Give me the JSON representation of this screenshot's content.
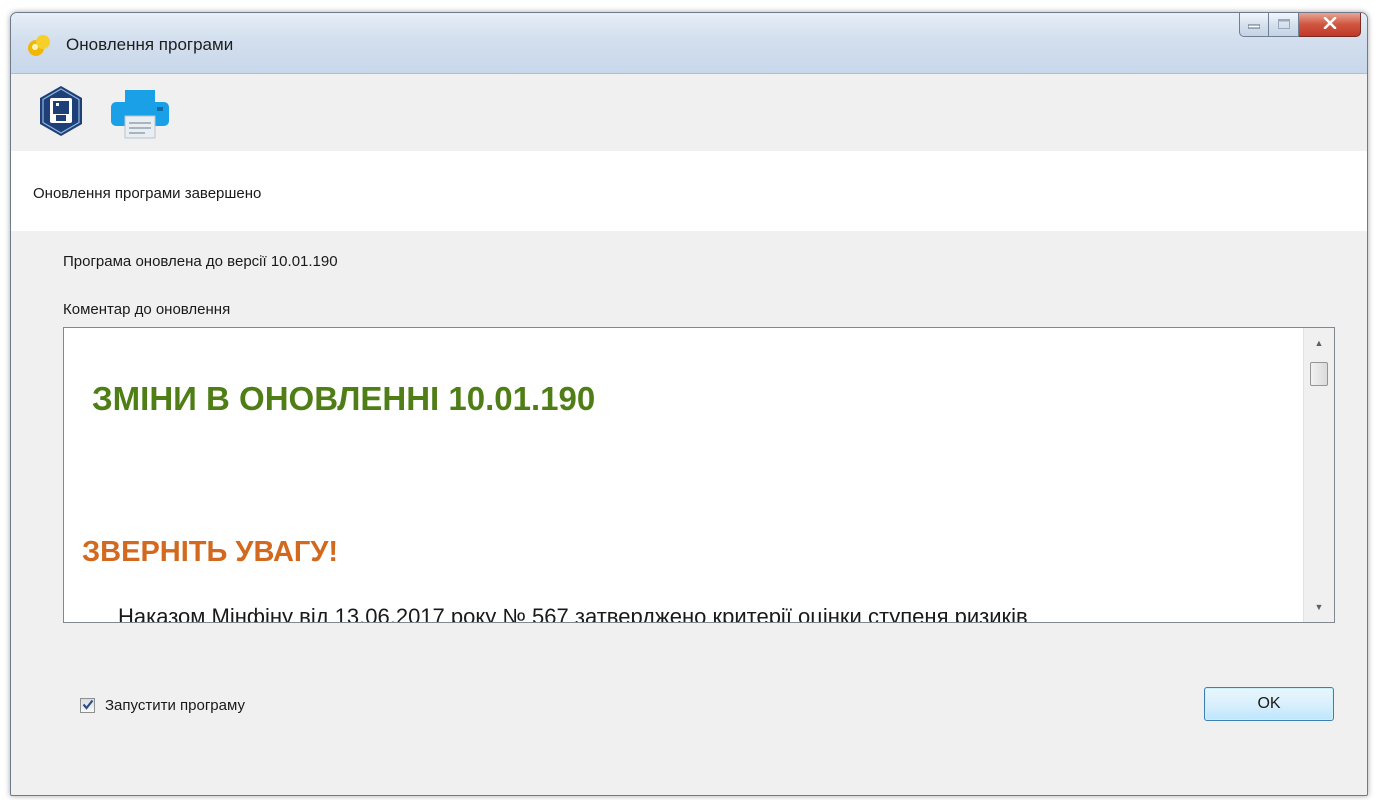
{
  "window": {
    "title": "Оновлення програми"
  },
  "toolbar": {
    "items": [
      {
        "icon": "save-icon"
      },
      {
        "icon": "printer-icon"
      }
    ]
  },
  "status": {
    "text": "Оновлення програми завершено"
  },
  "info": {
    "version_text": "Програма оновлена до версії 10.01.190",
    "comment_label": "Коментар до оновлення"
  },
  "comment": {
    "heading": "ЗМІНИ В ОНОВЛЕННІ 10.01.190",
    "warning": "ЗВЕРНІТЬ УВАГУ!",
    "paragraph": "Наказом Мінфіну від 13.06.2017 року № 567 затверджено критерії оцінки ступеня ризиків",
    "heading_color": "#4f7e16",
    "warning_color": "#d2691e"
  },
  "footer": {
    "run_program_label": "Запустити програму",
    "run_program_checked": true,
    "ok_label": "OK"
  },
  "colors": {
    "titlebar": "#d3dfee",
    "close_button": "#c0392b",
    "background": "#f0f0f0"
  }
}
